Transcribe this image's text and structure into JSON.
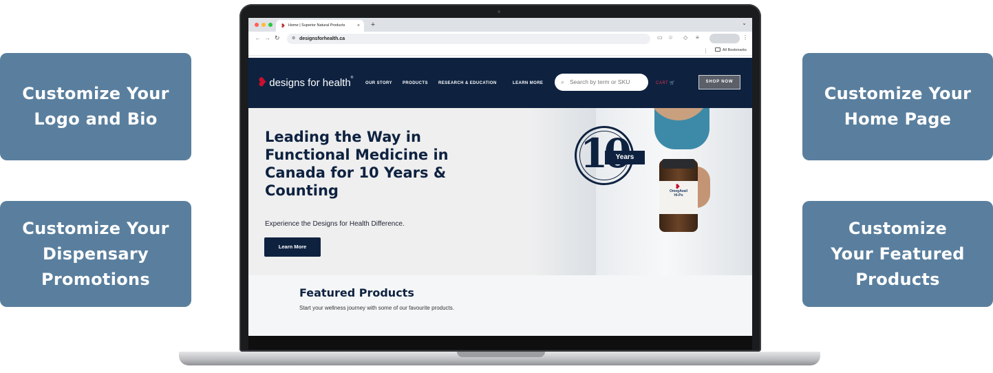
{
  "callouts": {
    "logo_bio": [
      "Customize Your",
      "Logo and Bio"
    ],
    "dispensary": [
      "Customize Your",
      "Dispensary",
      "Promotions"
    ],
    "home_page": [
      "Customize Your",
      "Home Page"
    ],
    "featured": [
      "Customize",
      "Your Featured",
      "Products"
    ]
  },
  "browser": {
    "tab_title": "Home | Superior Natural Products",
    "tab_close": "×",
    "new_tab": "+",
    "tab_menu": "⌄",
    "back": "←",
    "forward": "→",
    "reload": "↻",
    "url": "designsforhealth.ca",
    "bookmarks_label": "All Bookmarks",
    "traffic_colors": [
      "#ff5f57",
      "#febc2e",
      "#28c840"
    ]
  },
  "site": {
    "logo_text": "designs for health",
    "logo_reg": "®",
    "nav": [
      "OUR STORY",
      "PRODUCTS",
      "RESEARCH & EDUCATION",
      "LEARN MORE"
    ],
    "search_placeholder": "Search by term or SKU",
    "cart_label": "CART",
    "shop_now": "SHOP NOW"
  },
  "hero": {
    "title_lines": [
      "Leading the Way in",
      "Functional Medicine in",
      "Canada for 10 Years &",
      "Counting"
    ],
    "subtitle": "Experience the Designs for Health Difference.",
    "button": "Learn More",
    "badge_number": "10",
    "badge_word": "Years",
    "bottle_label_lines": [
      "OmegAvail",
      "Hi-Po"
    ]
  },
  "featured": {
    "title": "Featured Products",
    "subtitle": "Start your wellness journey with some of our favourite products."
  },
  "colors": {
    "callout_bg": "#5a7f9e",
    "navy": "#0e2240",
    "brand_red": "#c8102e"
  }
}
